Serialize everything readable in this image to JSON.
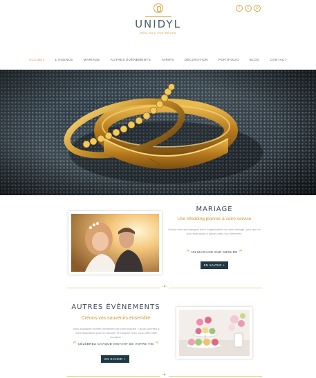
{
  "brand": {
    "name": "UNIDYL",
    "tagline": "RÉALISEZ VOS RÊVES",
    "accent": "#d4a640",
    "dark": "#1f3a44"
  },
  "social": [
    {
      "icon": "facebook-icon",
      "glyph": "f"
    },
    {
      "icon": "twitter-icon",
      "glyph": "t"
    },
    {
      "icon": "pinterest-icon",
      "glyph": "p"
    }
  ],
  "nav": {
    "items": [
      "Accueil",
      "L'agence",
      "Mariage",
      "Autres évènements",
      "Tarifs",
      "Décoration",
      "Portfolio",
      "Blog",
      "Contact"
    ]
  },
  "mariage": {
    "title": "Mariage",
    "subtitle": "Une Wedding planner à votre service",
    "body": "Unidyl vous accompagne dans l'organisation de votre mariage, pour que ce jour reste gravé à jamais dans vos mémoires.",
    "quote": "Un mariage sur mesure",
    "button": "En savoir +"
  },
  "events": {
    "title": "Autres évènements",
    "subtitle": "Créons vos souvenirs ensemble",
    "body": "Vous souhaitez profiter pleinement de votre journée ? Nous sommes à votre disposition pour en discuter et imaginer avec vous cette belle occasion !",
    "quote": "Célébrez chaque instant de votre vie",
    "button": "En savoir +"
  }
}
